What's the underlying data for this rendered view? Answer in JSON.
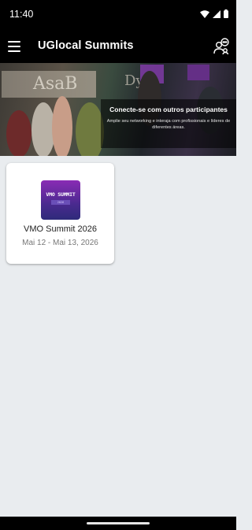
{
  "status_bar": {
    "time": "11:40"
  },
  "app_bar": {
    "title": "UGlocal Summits"
  },
  "banner": {
    "sign_text": "AsaB",
    "sign_text_2": "Dy",
    "heading": "Conecte-se com outros participantes",
    "subtext": "Amplie seu networking e interaja com profissionais e líderes de diferentes áreas."
  },
  "events": [
    {
      "logo_text": "VMO SUMMIT",
      "logo_subtext": "2026",
      "name": "VMO Summit 2026",
      "dates": "Mai 12 - Mai 13, 2026"
    }
  ],
  "colors": {
    "app_bar_bg": "#000000",
    "page_bg": "#e9ecef",
    "logo_gradient_top": "#8a2bb5",
    "logo_gradient_bottom": "#2e2a7a"
  },
  "icons": {
    "menu": "hamburger-icon",
    "people": "people-chat-icon",
    "wifi": "wifi-icon",
    "signal": "signal-icon",
    "battery": "battery-icon"
  }
}
